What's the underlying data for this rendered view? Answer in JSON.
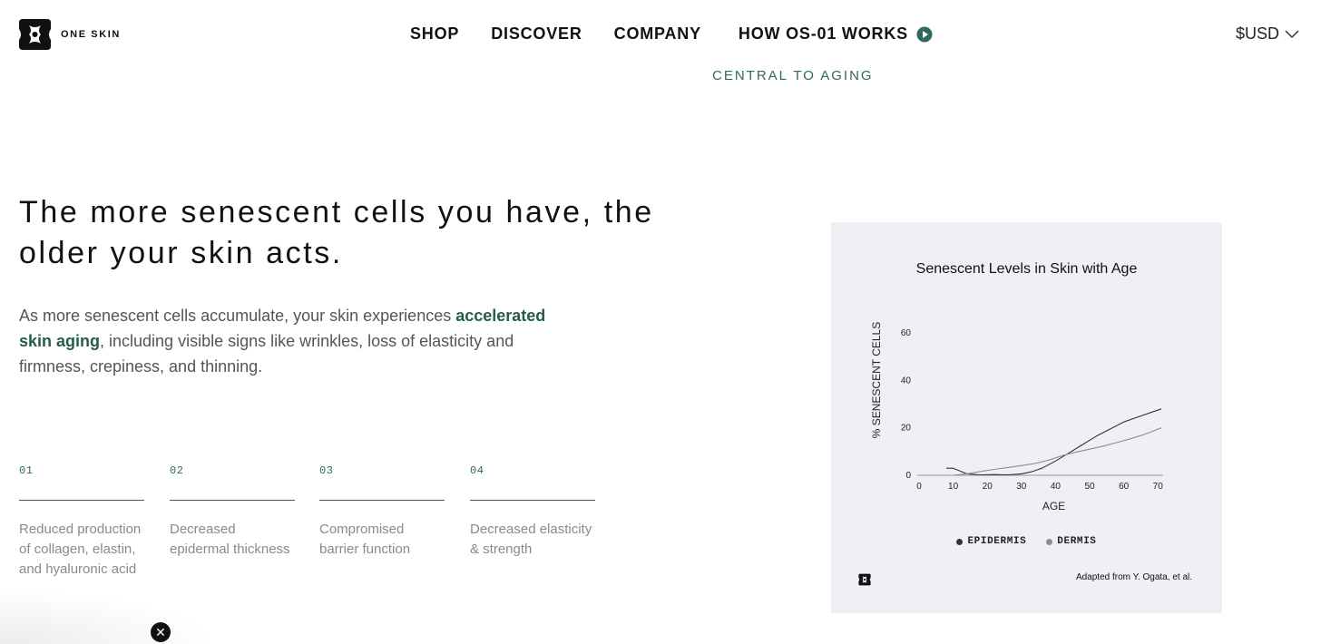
{
  "brand": {
    "name": "ONE SKIN",
    "logo_icon": "oneskin-logo-icon"
  },
  "nav": {
    "items": [
      "SHOP",
      "DISCOVER",
      "COMPANY",
      "HOW OS-01 WORKS"
    ],
    "how_icon": "play-circle-icon",
    "currency": "$USD",
    "currency_icon": "chevron-down-icon",
    "accent_color": "#2d6a5c"
  },
  "cut_label": "CENTRAL TO AGING",
  "headline": "The more senescent cells you have, the older your skin acts.",
  "body": {
    "before": "As more senescent cells accumulate, your skin experiences ",
    "accent": "accelerated skin aging",
    "after": ", including visible signs like wrinkles, loss of elasticity and firmness, crepiness, and thinning."
  },
  "steps": [
    {
      "num": "01",
      "text": "Reduced production of collagen, elastin, and hyaluronic acid"
    },
    {
      "num": "02",
      "text": "Decreased epidermal thickness"
    },
    {
      "num": "03",
      "text": "Compromised barrier function"
    },
    {
      "num": "04",
      "text": "Decreased elasticity & strength"
    }
  ],
  "close_glyph": "✕",
  "chart_data": {
    "type": "line",
    "title": "Senescent Levels in Skin with Age",
    "xlabel": "AGE",
    "ylabel": "% SENESCENT CELLS",
    "x_ticks": [
      "0",
      "10",
      "20",
      "30",
      "40",
      "50",
      "60",
      "70"
    ],
    "y_ticks": [
      "0",
      "20",
      "40",
      "60"
    ],
    "xlim": [
      0,
      71
    ],
    "ylim": [
      0,
      65
    ],
    "series": [
      {
        "name": "EPIDERMIS",
        "color": "#333333",
        "x": [
          8,
          10,
          12,
          14,
          18,
          22,
          26,
          30,
          33,
          36,
          40,
          44,
          48,
          52,
          56,
          60,
          64,
          68,
          71
        ],
        "y": [
          3,
          3,
          1.8,
          0.6,
          0.2,
          0.3,
          0.2,
          0.6,
          1.5,
          3,
          6,
          9.5,
          13,
          16.5,
          19.5,
          22.5,
          24.5,
          26.5,
          28
        ]
      },
      {
        "name": "DERMIS",
        "color": "#8d8d8d",
        "x": [
          10,
          14,
          18,
          22,
          26,
          30,
          34,
          38,
          42,
          46,
          50,
          54,
          58,
          62,
          66,
          71
        ],
        "y": [
          0,
          0.6,
          1.6,
          2.5,
          3.3,
          4.1,
          5,
          6.4,
          8.3,
          9.8,
          11,
          12.3,
          13.8,
          15.4,
          17.2,
          20
        ]
      }
    ],
    "grid": false,
    "legend": "bottom-center",
    "attribution": "Adapted from Y. Ogata, et al."
  }
}
